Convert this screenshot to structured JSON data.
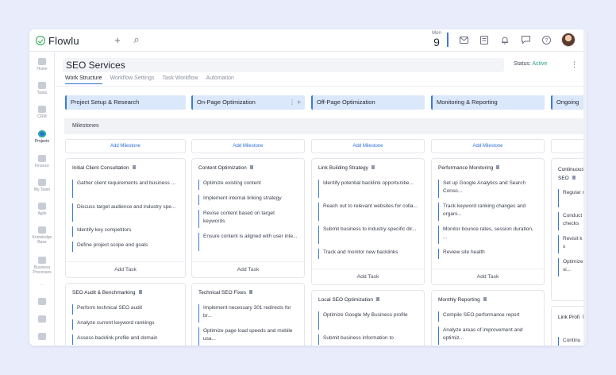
{
  "app": {
    "name": "Flowlu"
  },
  "topbar": {
    "add_icon": "+",
    "search_icon": "⌕",
    "date_month": "Mon",
    "date_day": "9",
    "icons": [
      "mail-icon",
      "notes-icon",
      "bell-icon",
      "chat-icon",
      "help-icon"
    ]
  },
  "sidebar": {
    "items": [
      {
        "label": "Home"
      },
      {
        "label": "Tasks"
      },
      {
        "label": "CRM"
      },
      {
        "label": "Projects"
      },
      {
        "label": "Finance"
      },
      {
        "label": "My Team"
      },
      {
        "label": "Agile"
      },
      {
        "label": "Knowledge Base"
      },
      {
        "label": "Business Processes"
      },
      {
        "label": "..."
      }
    ]
  },
  "project": {
    "title": "SEO Services",
    "status_label": "Status:",
    "status_value": "Active",
    "tabs": [
      "Work Structure",
      "Workflow Settings",
      "Task Workflow",
      "Automation"
    ]
  },
  "board": {
    "milestones_label": "Milestones",
    "add_milestone_label": "Add Milestone",
    "add_task_label": "Add Task",
    "stages": [
      {
        "name": "Project Setup & Research"
      },
      {
        "name": "On-Page Optimization",
        "actions": "⋮ +"
      },
      {
        "name": "Off-Page Optimization"
      },
      {
        "name": "Monitoring & Reporting"
      },
      {
        "name": "Ongoing"
      }
    ],
    "columns": [
      {
        "cards": [
          {
            "title": "Initial Client Consultation",
            "tasks": [
              "Gather client requirements and business ...",
              "Discuss target audience and industry spe...",
              "Identify key competitors",
              "Define project scope and goals"
            ],
            "add_task": true
          },
          {
            "title": "SEO Audit & Benchmarking",
            "tasks": [
              "Perform technical SEO audit",
              "Analyze current keyword rankings",
              "Assess backlink profile and domain"
            ],
            "add_task": false
          }
        ]
      },
      {
        "cards": [
          {
            "title": "Content Optimization",
            "tasks": [
              "Optimize existing content",
              "Implement internal linking strategy",
              "Revise content based on target keywords",
              "Ensure content is aligned with user inte..."
            ],
            "add_task": true
          },
          {
            "title": "Technical SEO Fixes",
            "tasks": [
              "Implement necessary 301 redirects for br...",
              "Optimize page load speeds and mobile usa..."
            ],
            "add_task": false
          }
        ]
      },
      {
        "cards": [
          {
            "title": "Link Building Strategy",
            "tasks": [
              "Identify potential backlink opportunitie...",
              "Reach out to relevant websites for colla...",
              "Submit business to industry-specific dir...",
              "Track and monitor new backlinks"
            ],
            "add_task": true
          },
          {
            "title": "Local SEO Optimization",
            "tasks": [
              "Optimize Google My Business profile",
              "Submit business information to"
            ],
            "add_task": false
          }
        ]
      },
      {
        "cards": [
          {
            "title": "Performance Monitoring",
            "tasks": [
              "Set up Google Analytics and Search Conso...",
              "Track keyword ranking changes and organi...",
              "Monitor bounce rates, session duration, ...",
              "Review site health"
            ],
            "add_task": true
          },
          {
            "title": "Monthly Reporting",
            "tasks": [
              "Compile SEO performance report",
              "Analyze areas of improvement and optimiz..."
            ],
            "add_task": false
          }
        ]
      },
      {
        "cards": [
          {
            "title": "Continuous SEO",
            "tasks": [
              "Regular re...",
              "Conduct checks",
              "Revisit k adjust s",
              "Optimize the si..."
            ],
            "add_task": false
          },
          {
            "title": "Link Profi",
            "tasks": [
              "Continu"
            ],
            "add_task": false
          }
        ]
      }
    ]
  }
}
